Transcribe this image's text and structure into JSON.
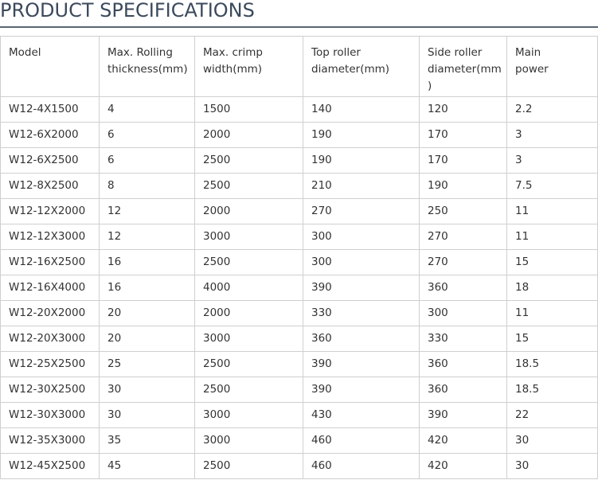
{
  "page": {
    "title": "PRODUCT SPECIFICATIONS"
  },
  "table": {
    "headers": {
      "model": "Model",
      "thickness_line1": "Max. Rolling",
      "thickness_line2": "thickness(mm)",
      "width_line1": "Max. crimp",
      "width_line2": "width(mm)",
      "top_line1": "Top roller",
      "top_line2": "diameter(mm)",
      "side_line1": "Side roller",
      "side_line2": "diameter(mm",
      "side_line3": ")",
      "power_line1": "Main",
      "power_line2": "power"
    },
    "rows": [
      [
        "W12-4X1500",
        "4",
        "1500",
        "140",
        "120",
        "2.2"
      ],
      [
        "W12-6X2000",
        "6",
        "2000",
        "190",
        "170",
        "3"
      ],
      [
        "W12-6X2500",
        "6",
        "2500",
        "190",
        "170",
        "3"
      ],
      [
        "W12-8X2500",
        "8",
        "2500",
        "210",
        "190",
        "7.5"
      ],
      [
        "W12-12X2000",
        "12",
        "2000",
        "270",
        "250",
        "11"
      ],
      [
        "W12-12X3000",
        "12",
        "3000",
        "300",
        "270",
        "11"
      ],
      [
        "W12-16X2500",
        "16",
        "2500",
        "300",
        "270",
        "15"
      ],
      [
        "W12-16X4000",
        "16",
        "4000",
        "390",
        "360",
        "18"
      ],
      [
        "W12-20X2000",
        "20",
        "2000",
        "330",
        "300",
        "11"
      ],
      [
        "W12-20X3000",
        "20",
        "3000",
        "360",
        "330",
        "15"
      ],
      [
        "W12-25X2500",
        "25",
        "2500",
        "390",
        "360",
        "18.5"
      ],
      [
        "W12-30X2500",
        "30",
        "2500",
        "390",
        "360",
        "18.5"
      ],
      [
        "W12-30X3000",
        "30",
        "3000",
        "430",
        "390",
        "22"
      ],
      [
        "W12-35X3000",
        "35",
        "3000",
        "460",
        "420",
        "30"
      ],
      [
        "W12-45X2500",
        "45",
        "2500",
        "460",
        "420",
        "30"
      ]
    ]
  }
}
